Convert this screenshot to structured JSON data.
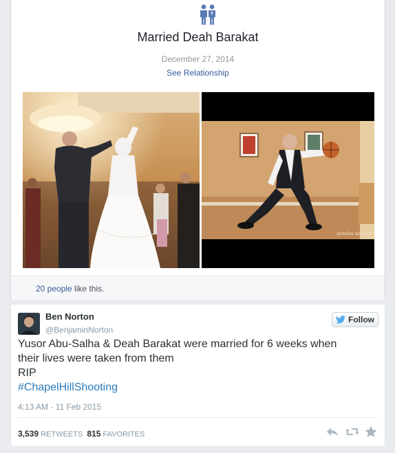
{
  "facebook": {
    "event_icon": "couple-icon",
    "event_title": "Married Deah Barakat",
    "date": "December 27, 2014",
    "link_label": "See Relationship",
    "likes_count": "20 people",
    "likes_suffix": " like this.",
    "photos": [
      {
        "subject": "wedding-dance-photo"
      },
      {
        "subject": "groom-dribbling-basketball-photo"
      }
    ],
    "photo_watermark": "ayesha ahmad"
  },
  "tweet": {
    "name": "Ben Norton",
    "handle": "@BenjaminNorton",
    "follow_label": "Follow",
    "text_line1": "Yusor Abu-Salha & Deah Barakat were married for 6 weeks when",
    "text_line2": "their lives were taken from them",
    "text_line3": "RIP",
    "hashtag": "#ChapelHillShooting",
    "timestamp": "4:13 AM - 11 Feb 2015",
    "retweets_count": "3,539",
    "retweets_label": "RETWEETS",
    "favorites_count": "815",
    "favorites_label": "FAVORITES",
    "actions": [
      "reply-icon",
      "retweet-icon",
      "favorite-icon"
    ]
  },
  "colors": {
    "fb_blue": "#365899",
    "twitter_blue": "#2b7bb9",
    "twitter_bird": "#55acee",
    "icon_gray": "#aab8c2"
  }
}
